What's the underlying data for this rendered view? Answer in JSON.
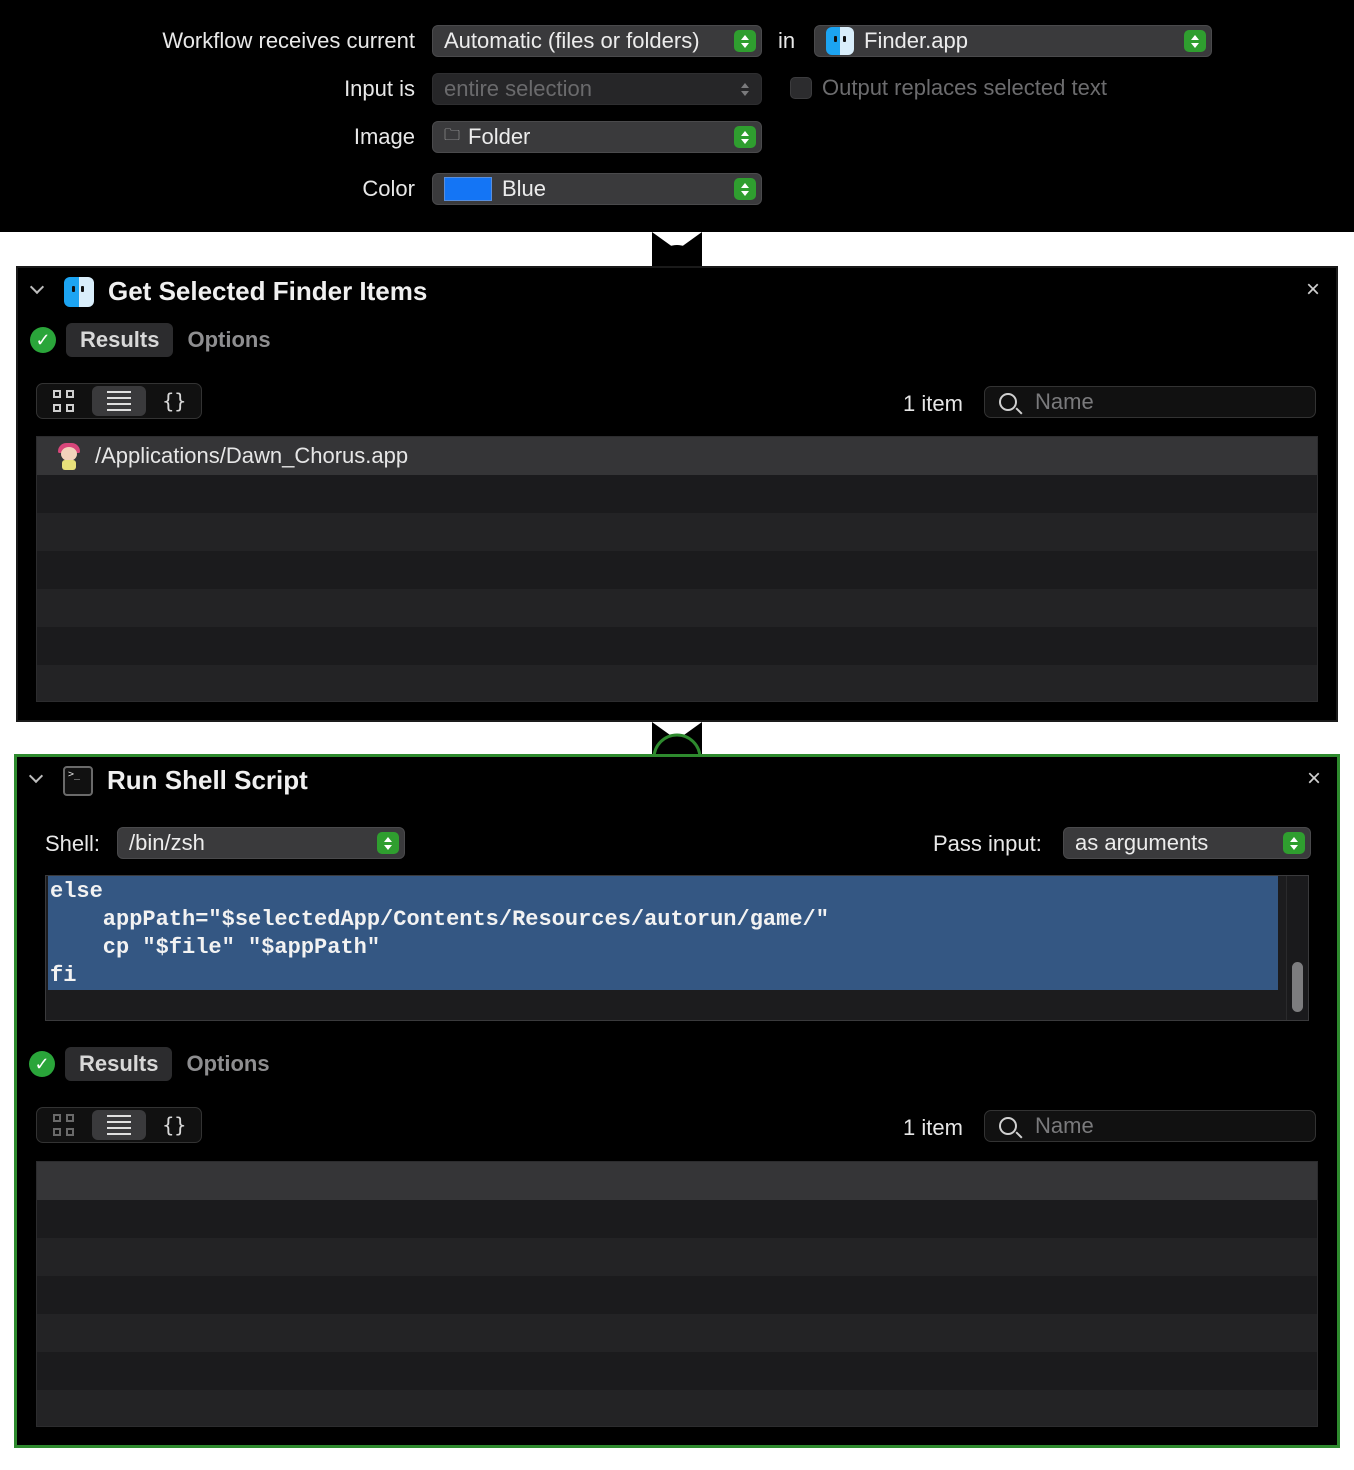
{
  "workflow": {
    "receives_label": "Workflow receives current",
    "receives_value": "Automatic (files or folders)",
    "in_label": "in",
    "app_value": "Finder.app",
    "input_is_label": "Input is",
    "input_is_value": "entire selection",
    "output_replaces_label": "Output replaces selected text",
    "image_label": "Image",
    "image_value": "Folder",
    "color_label": "Color",
    "color_value": "Blue",
    "swatch_color": "#1475f5"
  },
  "action1": {
    "title": "Get Selected Finder Items",
    "close": "×",
    "tab_results": "Results",
    "tab_options": "Options",
    "json_view": "{}",
    "count": "1 item",
    "search_placeholder": "Name",
    "rows": [
      "/Applications/Dawn_Chorus.app"
    ]
  },
  "action2": {
    "title": "Run Shell Script",
    "close": "×",
    "shell_label": "Shell:",
    "shell_value": "/bin/zsh",
    "pass_input_label": "Pass input:",
    "pass_input_value": "as arguments",
    "code": "else\n    appPath=\"$selectedApp/Contents/Resources/autorun/game/\"\n    cp \"$file\" \"$appPath\"\nfi",
    "tab_results": "Results",
    "tab_options": "Options",
    "json_view": "{}",
    "count": "1 item",
    "search_placeholder": "Name"
  },
  "colors": {
    "accent_green": "#2e8a2e",
    "selection_blue": "#345783"
  }
}
